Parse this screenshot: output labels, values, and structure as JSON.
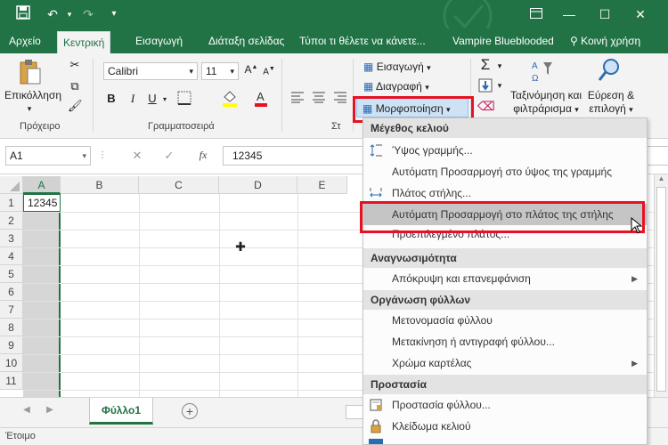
{
  "titlebar": {
    "save_icon": "save-icon",
    "undo_icon": "undo-icon",
    "redo_icon": "redo-icon",
    "customize_icon": "chevron-down-icon",
    "ribbon_display_icon": "ribbon-display-icon",
    "minimize": "—",
    "maximize": "☐",
    "close": "✕",
    "accent": "#217346"
  },
  "tabs": {
    "file": "Αρχείο",
    "home": "Κεντρική",
    "insert": "Εισαγωγή",
    "layout": "Διάταξη σελίδας",
    "tell_me": "Τύποι τι θέλετε να κάνετε...",
    "user": "Vampire Blueblooded",
    "share": "Κοινή χρήση"
  },
  "ribbon": {
    "paste_label": "Επικόλληση",
    "clipboard_group": "Πρόχειρο",
    "font_name": "Calibri",
    "font_size": "11",
    "bold": "B",
    "italic": "I",
    "underline": "U",
    "font_group": "Γραμματοσειρά",
    "alignment_group_partial": "Στ",
    "insert_cells": "Εισαγωγή",
    "delete_cells": "Διαγραφή",
    "format_cells": "Μορφοποίηση",
    "sort_filter_line1": "Ταξινόμηση και",
    "sort_filter_line2": "φιλτράρισμα",
    "find_select_line1": "Εύρεση &",
    "find_select_line2": "επιλογή"
  },
  "formula_bar": {
    "name_box": "A1",
    "fx": "fx",
    "value": "12345"
  },
  "grid": {
    "columns": [
      "A",
      "B",
      "C",
      "D",
      "E"
    ],
    "rows": [
      "1",
      "2",
      "3",
      "4",
      "5",
      "6",
      "7",
      "8",
      "9",
      "10",
      "11"
    ],
    "a1_value": "12345"
  },
  "sheets": {
    "active": "Φύλλο1",
    "add": "+"
  },
  "status": {
    "ready": "Έτοιμο"
  },
  "format_menu": {
    "cell_size_header": "Μέγεθος κελιού",
    "row_height": "Ύψος γραμμής...",
    "autofit_row": "Αυτόματη Προσαρμογή στο ύψος της γραμμής",
    "column_width": "Πλάτος στήλης...",
    "autofit_column": "Αυτόματη Προσαρμογή στο πλάτος της στήλης",
    "default_width": "Προεπιλεγμένο πλάτος...",
    "visibility_header": "Αναγνωσιμότητα",
    "hide_unhide": "Απόκρυψη και επανεμφάνιση",
    "organize_header": "Οργάνωση φύλλων",
    "rename_sheet": "Μετονομασία φύλλου",
    "move_copy": "Μετακίνηση ή αντιγραφή φύλλου...",
    "tab_color": "Χρώμα καρτέλας",
    "protection_header": "Προστασία",
    "protect_sheet": "Προστασία φύλλου...",
    "lock_cell": "Κλείδωμα κελιού"
  },
  "highlight_color": "#e81123"
}
